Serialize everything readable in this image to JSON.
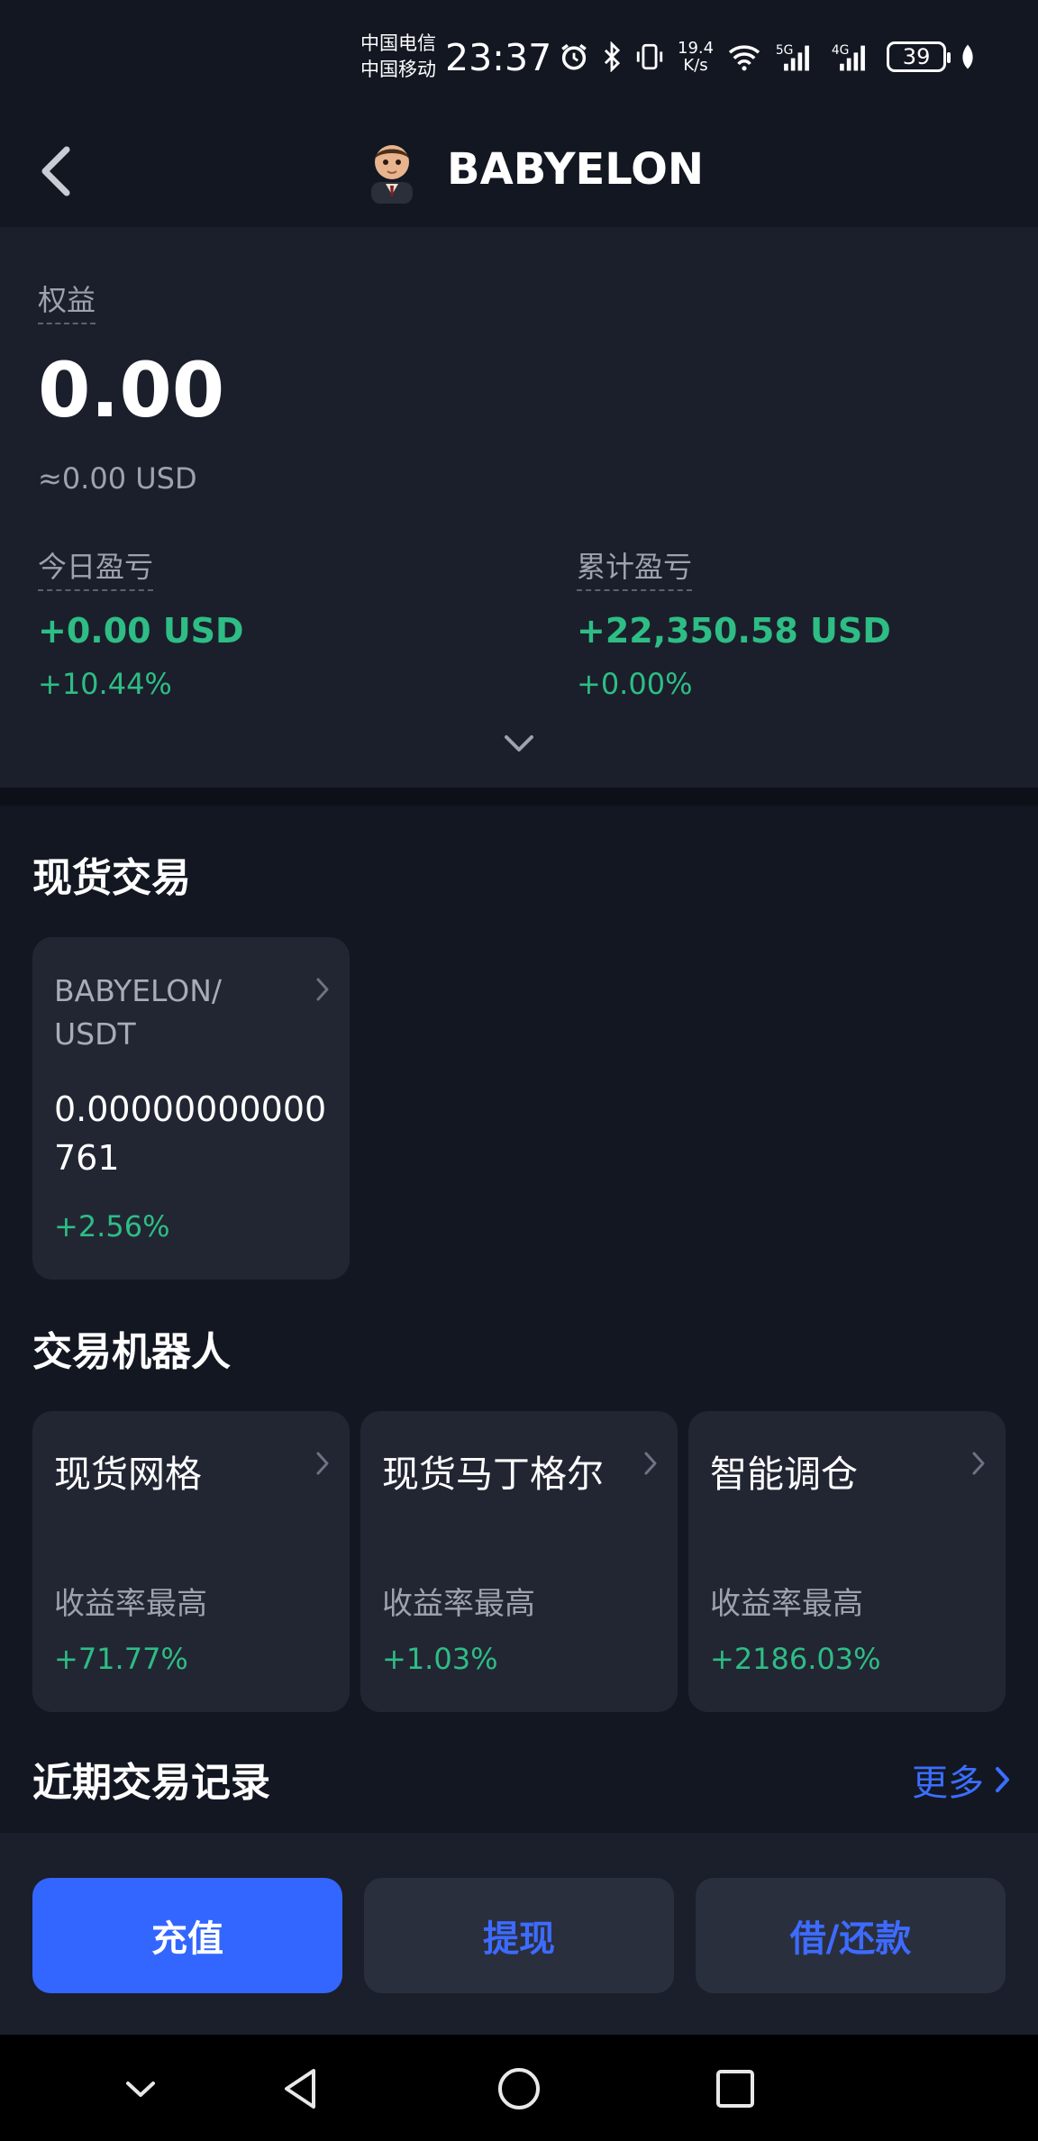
{
  "status_bar": {
    "carrier_1": "中国电信",
    "carrier_2": "中国移动",
    "time": "23:37",
    "net_speed_value": "19.4",
    "net_speed_unit": "K/s",
    "battery": "39",
    "icons": [
      "alarm-icon",
      "bluetooth-icon",
      "vibrate-icon",
      "wifi-icon",
      "signal-5g-icon",
      "signal-4g-icon",
      "battery-icon",
      "leaf-icon"
    ]
  },
  "header": {
    "title": "BABYELON",
    "back_icon": "chevron-left-icon",
    "avatar": "baby-avatar"
  },
  "equity": {
    "label": "权益",
    "value": "0.00",
    "usd": "≈0.00 USD",
    "today_pnl": {
      "label": "今日盈亏",
      "value": "+0.00 USD",
      "percent": "+10.44%"
    },
    "total_pnl": {
      "label": "累计盈亏",
      "value": "+22,350.58 USD",
      "percent": "+0.00%"
    }
  },
  "spot": {
    "title": "现货交易",
    "card": {
      "pair": "BABYELON/ USDT",
      "price": "0.00000000000761",
      "change": "+2.56%"
    }
  },
  "bots": {
    "title": "交易机器人",
    "items": [
      {
        "name": "现货网格",
        "sub": "收益率最高",
        "rate": "+71.77%"
      },
      {
        "name": "现货马丁格尔",
        "sub": "收益率最高",
        "rate": "+1.03%"
      },
      {
        "name": "智能调仓",
        "sub": "收益率最高",
        "rate": "+2186.03%"
      }
    ]
  },
  "recent": {
    "title": "近期交易记录",
    "more": "更多"
  },
  "actions": {
    "deposit": "充值",
    "withdraw": "提现",
    "borrow": "借/还款"
  },
  "colors": {
    "background": "#131722",
    "panel": "#1b1f2b",
    "card": "#222633",
    "positive": "#2ebd85",
    "accent": "#3366ff"
  }
}
